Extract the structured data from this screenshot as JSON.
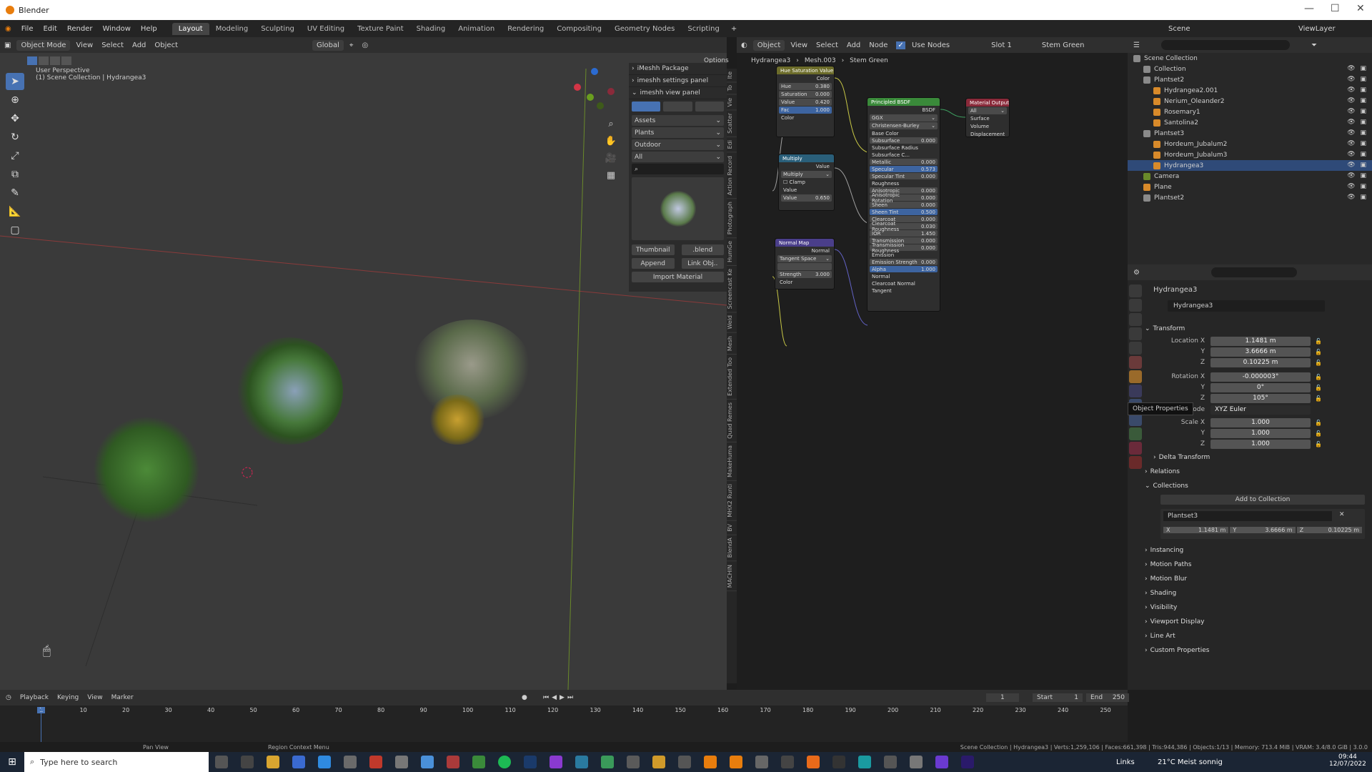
{
  "window": {
    "title": "Blender"
  },
  "menu": {
    "items": [
      "File",
      "Edit",
      "Render",
      "Window",
      "Help"
    ],
    "workspaces": [
      "Layout",
      "Modeling",
      "Sculpting",
      "UV Editing",
      "Texture Paint",
      "Shading",
      "Animation",
      "Rendering",
      "Compositing",
      "Geometry Nodes",
      "Scripting"
    ],
    "active_workspace": "Layout",
    "scene": "Scene",
    "viewlayer": "ViewLayer"
  },
  "viewport": {
    "mode": "Object Mode",
    "menu": [
      "View",
      "Select",
      "Add",
      "Object"
    ],
    "transform": "Global",
    "options": "Options",
    "overlay_line1": "User Perspective",
    "overlay_line2": "(1) Scene Collection | Hydrangea3"
  },
  "npanel": {
    "items": [
      "iMeshh Package",
      "imeshh settings panel",
      "imeshh view panel"
    ],
    "selects": [
      "Assets",
      "Plants",
      "Outdoor",
      "All"
    ],
    "thumbnail": "Thumbnail",
    "blend": ".blend",
    "append": "Append",
    "link": "Link Obj..",
    "import": "Import Material"
  },
  "vertical_tabs": [
    "Ite",
    "To",
    "Vie",
    "Scatter",
    "Edi",
    "Action Record",
    "Photograph",
    "HumGe",
    "Screencast Ke",
    "Weld",
    "Mesh",
    "Extended Too",
    "Quad Remes",
    "MakeHuma",
    "MHX2 Runti",
    "BV",
    "BlendA",
    "MACHIN"
  ],
  "node_editor": {
    "menu": [
      "Object",
      "View",
      "Select",
      "Add",
      "Node"
    ],
    "use_nodes": "Use Nodes",
    "slot": "Slot 1",
    "material": "Stem Green",
    "breadcrumb": [
      "Hydrangea3",
      "Mesh.003",
      "Stem Green"
    ],
    "hue_sat": {
      "title": "Hue Saturation Value",
      "out": "Color",
      "rows": [
        [
          "Hue",
          "0.380"
        ],
        [
          "Saturation",
          "0.000"
        ],
        [
          "Value",
          "0.420"
        ],
        [
          "Fac",
          "1.000"
        ]
      ],
      "in": "Color"
    },
    "multiply": {
      "title": "Multiply",
      "out": "Value",
      "op": "Multiply",
      "clamp": "Clamp",
      "in": "Value",
      "val_label": "Value",
      "val": "0.650"
    },
    "normal_map": {
      "title": "Normal Map",
      "out": "Normal",
      "space": "Tangent Space",
      "strength_label": "Strength",
      "strength": "3.000",
      "in": "Color"
    },
    "bsdf": {
      "title": "Principled BSDF",
      "out": "BSDF",
      "dist": "GGX",
      "sss": "Christensen-Burley",
      "rows": [
        [
          "Base Color",
          ""
        ],
        [
          "Subsurface",
          "0.000"
        ],
        [
          "Subsurface Radius",
          ""
        ],
        [
          "Subsurface C...",
          ""
        ],
        [
          "Metallic",
          "0.000"
        ],
        [
          "Specular",
          "0.573"
        ],
        [
          "Specular Tint",
          "0.000"
        ],
        [
          "Roughness",
          ""
        ],
        [
          "Anisotropic",
          "0.000"
        ],
        [
          "Anisotropic Rotation",
          "0.000"
        ],
        [
          "Sheen",
          "0.000"
        ],
        [
          "Sheen Tint",
          "0.500"
        ],
        [
          "Clearcoat",
          "0.000"
        ],
        [
          "Clearcoat Roughness",
          "0.030"
        ],
        [
          "IOR",
          "1.450"
        ],
        [
          "Transmission",
          "0.000"
        ],
        [
          "Transmission Roughness",
          "0.000"
        ],
        [
          "Emission",
          ""
        ],
        [
          "Emission Strength",
          "0.000"
        ],
        [
          "Alpha",
          "1.000"
        ],
        [
          "Normal",
          ""
        ],
        [
          "Clearcoat Normal",
          ""
        ],
        [
          "Tangent",
          ""
        ]
      ]
    },
    "output": {
      "title": "Material Output",
      "target": "All",
      "rows": [
        "Surface",
        "Volume",
        "Displacement"
      ]
    }
  },
  "outliner": {
    "root": "Scene Collection",
    "rows": [
      {
        "name": "Collection",
        "indent": 1
      },
      {
        "name": "Plantset2",
        "indent": 1
      },
      {
        "name": "Hydrangea2.001",
        "indent": 2
      },
      {
        "name": "Nerium_Oleander2",
        "indent": 2
      },
      {
        "name": "Rosemary1",
        "indent": 2
      },
      {
        "name": "Santolina2",
        "indent": 2
      },
      {
        "name": "Plantset3",
        "indent": 1
      },
      {
        "name": "Hordeum_Jubalum2",
        "indent": 2
      },
      {
        "name": "Hordeum_Jubalum3",
        "indent": 2
      },
      {
        "name": "Hydrangea3",
        "indent": 2,
        "selected": true
      },
      {
        "name": "Camera",
        "indent": 1
      },
      {
        "name": "Plane",
        "indent": 1
      },
      {
        "name": "Plantset2",
        "indent": 1
      }
    ]
  },
  "properties": {
    "object": "Hydrangea3",
    "object_field": "Hydrangea3",
    "transform": "Transform",
    "location_label": "Location X",
    "location": [
      "1.1481 m",
      "3.6666 m",
      "0.10225 m"
    ],
    "rotation_label": "Rotation X",
    "rotation": [
      "-0.000003°",
      "0°",
      "105°"
    ],
    "mode_label": "Mode",
    "mode": "XYZ Euler",
    "scale_label": "Scale X",
    "scale": [
      "1.000",
      "1.000",
      "1.000"
    ],
    "y": "Y",
    "z": "Z",
    "tooltip": "Object Properties",
    "delta": "Delta Transform",
    "relations": "Relations",
    "collections": "Collections",
    "add_collection": "Add to Collection",
    "collection_name": "Plantset3",
    "coll_x": "X",
    "coll_y": "Y",
    "coll_z": "Z",
    "coll_vals": [
      "1.1481 m",
      "3.6666 m",
      "0.10225 m"
    ],
    "sections": [
      "Instancing",
      "Motion Paths",
      "Motion Blur",
      "Shading",
      "Visibility",
      "Viewport Display",
      "Line Art",
      "Custom Properties"
    ]
  },
  "timeline": {
    "menu": [
      "Playback",
      "Keying",
      "View",
      "Marker"
    ],
    "current": "1",
    "start_label": "Start",
    "start": "1",
    "end_label": "End",
    "end": "250",
    "ticks": [
      "1",
      "10",
      "20",
      "30",
      "40",
      "50",
      "60",
      "70",
      "80",
      "90",
      "100",
      "110",
      "120",
      "130",
      "140",
      "150",
      "160",
      "170",
      "180",
      "190",
      "200",
      "210",
      "220",
      "230",
      "240",
      "250"
    ]
  },
  "status": {
    "left": "Pan View",
    "middle": "Region Context Menu",
    "right": "Scene Collection | Hydrangea3 | Verts:1,259,106 | Faces:661,398 | Tris:944,386 | Objects:1/13 | Memory: 713.4 MiB | VRAM: 3.4/8.0 GiB | 3.0.0"
  },
  "taskbar": {
    "search": "Type here to search",
    "links": "Links",
    "weather": "21°C  Meist sonnig",
    "time": "09:44",
    "date": "12/07/2022"
  },
  "colors": {
    "accent": "#4772b3",
    "selected": "#2f4a78",
    "orange": "#e87d0d"
  }
}
